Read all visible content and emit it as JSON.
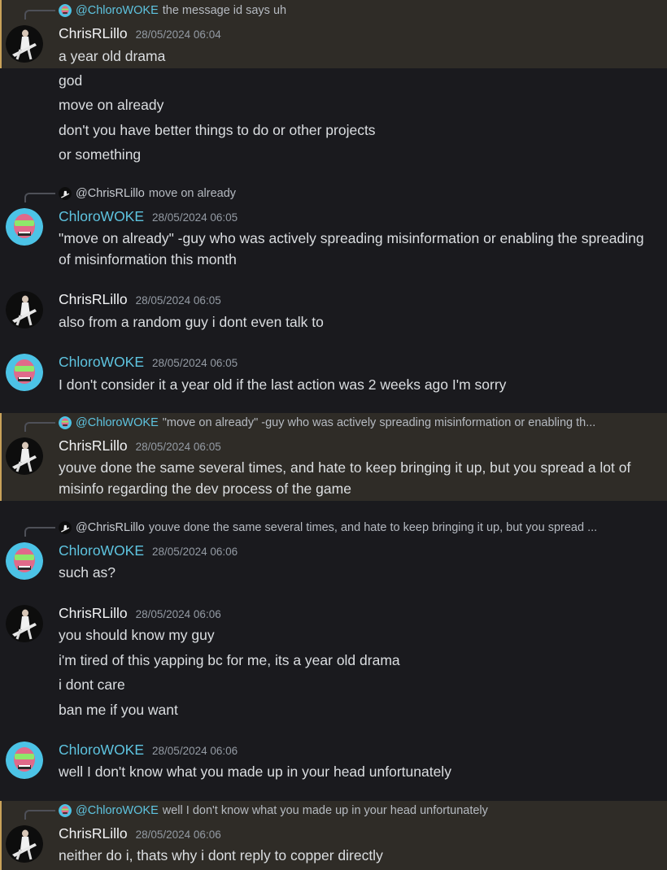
{
  "users": {
    "chris": "ChrisRLillo",
    "chloro": "ChloroWOKE"
  },
  "messages": [
    {
      "reply": {
        "author": "@ChloroWOKE",
        "text": "the message id says uh"
      },
      "author": "ChrisRLillo",
      "timestamp": "28/05/2024 06:04",
      "lines": [
        "a year old drama",
        "god",
        "move on already",
        "don't you have better things to do or other projects",
        "or something"
      ]
    },
    {
      "reply": {
        "author": "@ChrisRLillo",
        "text": "move on already"
      },
      "author": "ChloroWOKE",
      "timestamp": "28/05/2024 06:05",
      "lines": [
        "\"move on already\" -guy who was actively spreading misinformation or enabling the spreading of misinformation this month"
      ]
    },
    {
      "author": "ChrisRLillo",
      "timestamp": "28/05/2024 06:05",
      "lines": [
        "also from a random guy i dont even talk to"
      ]
    },
    {
      "author": "ChloroWOKE",
      "timestamp": "28/05/2024 06:05",
      "lines": [
        "I don't consider it a year old if the last action was 2 weeks ago I'm sorry"
      ]
    },
    {
      "reply": {
        "author": "@ChloroWOKE",
        "text": "\"move on already\" -guy who was actively spreading misinformation or enabling th..."
      },
      "author": "ChrisRLillo",
      "timestamp": "28/05/2024 06:05",
      "lines": [
        "youve done the same several times, and hate to keep bringing it up, but you spread a lot of misinfo regarding the dev process of the game"
      ]
    },
    {
      "reply": {
        "author": "@ChrisRLillo",
        "text": "youve done the same several times, and hate to keep bringing it up, but you spread ..."
      },
      "author": "ChloroWOKE",
      "timestamp": "28/05/2024 06:06",
      "lines": [
        "such as?"
      ]
    },
    {
      "author": "ChrisRLillo",
      "timestamp": "28/05/2024 06:06",
      "lines": [
        "you should know my guy",
        "i'm tired of this yapping bc for me, its a year old drama",
        "i dont care",
        "ban me if you want"
      ]
    },
    {
      "author": "ChloroWOKE",
      "timestamp": "28/05/2024 06:06",
      "lines": [
        "well I don't know what you made up in your head unfortunately"
      ]
    },
    {
      "reply": {
        "author": "@ChloroWOKE",
        "text": "well I don't know what you made up in your head unfortunately"
      },
      "author": "ChrisRLillo",
      "timestamp": "28/05/2024 06:06",
      "lines": [
        "neither do i, thats why i dont reply to copper directly"
      ]
    }
  ],
  "colors": {
    "background": "#1a1a1e",
    "mention_highlight": "#2f2c27",
    "chloro_name": "#5ec4e0",
    "chris_name": "#f2f3f5"
  },
  "icons": {
    "chris_avatar": "guitarist-avatar-icon",
    "chloro_avatar": "cyan-face-avatar-icon"
  }
}
